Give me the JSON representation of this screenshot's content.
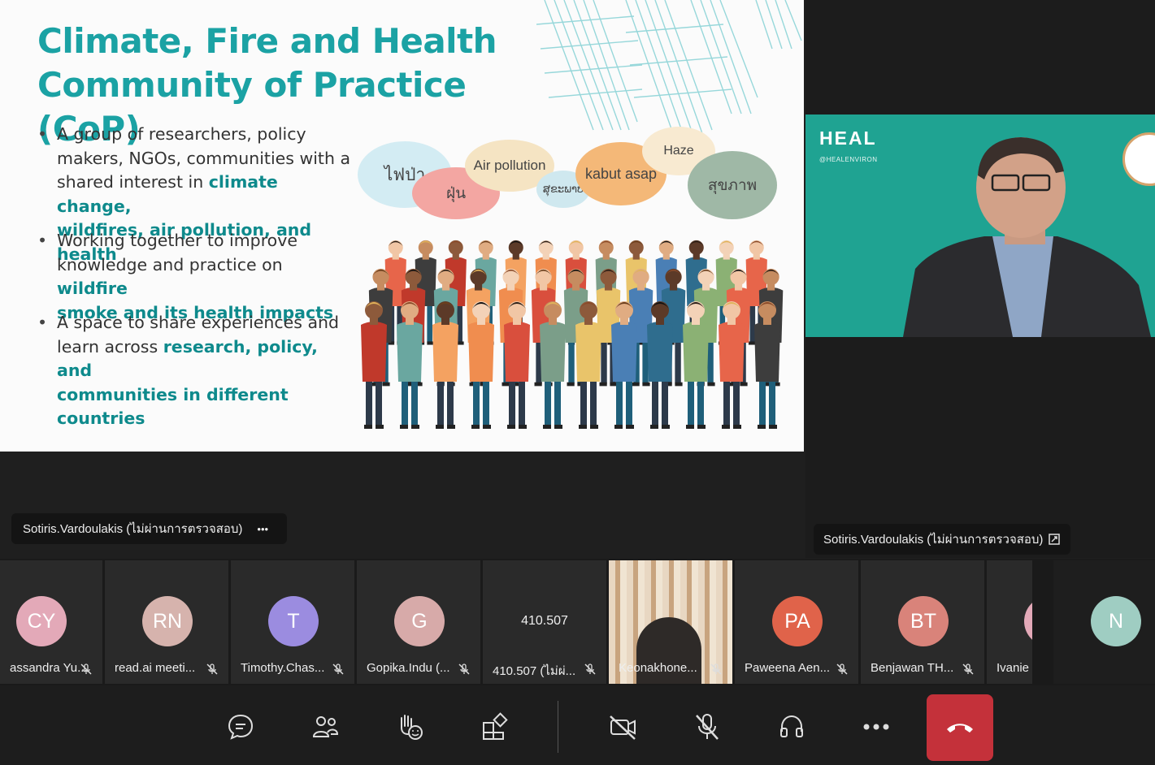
{
  "slide": {
    "title_line1": "Climate, Fire and Health",
    "title_line2": "Community of Practice (CoP)",
    "bullets": [
      {
        "lines": [
          [
            {
              "t": "A group of researchers, policy",
              "h": false
            }
          ],
          [
            {
              "t": "makers, NGOs, communities with a",
              "h": false
            }
          ],
          [
            {
              "t": "shared interest in ",
              "h": false
            },
            {
              "t": "climate change,",
              "h": true
            }
          ],
          [
            {
              "t": "wildfires, air pollution, and health",
              "h": true
            }
          ]
        ]
      },
      {
        "lines": [
          [
            {
              "t": "Working together to improve",
              "h": false
            }
          ],
          [
            {
              "t": "knowledge and practice on ",
              "h": false
            },
            {
              "t": "wildfire",
              "h": true
            }
          ],
          [
            {
              "t": "smoke and its health impacts",
              "h": true
            }
          ]
        ]
      },
      {
        "lines": [
          [
            {
              "t": "A space to share experiences and",
              "h": false
            }
          ],
          [
            {
              "t": "learn across ",
              "h": false
            },
            {
              "t": "research, policy, and",
              "h": true
            }
          ],
          [
            {
              "t": "communities in different countries",
              "h": true
            }
          ]
        ]
      }
    ],
    "bubbles": [
      "ไฟป่า",
      "ฝุ่น",
      "Air pollution",
      "ສຸຂະພາບ",
      "kabut asap",
      "Haze",
      "สุขภาพ"
    ]
  },
  "speaker": {
    "name_label": "Sotiris.Vardoulakis (ไม่ผ่านการตรวจสอบ)",
    "heal_logo": "HEAL",
    "heal_handle": "@HEALENVIRON"
  },
  "presenter_bar": {
    "name_label": "Sotiris.Vardoulakis (ไม่ผ่านการตรวจสอบ)",
    "more_label": "•••"
  },
  "participants": [
    {
      "initials": "CY",
      "name": "assandra Yu...",
      "color": "#e3a9b8"
    },
    {
      "initials": "RN",
      "name": "read.ai meeti...",
      "color": "#d6b3ad"
    },
    {
      "initials": "T",
      "name": "Timothy.Chas...",
      "color": "#9b8ce0"
    },
    {
      "initials": "G",
      "name": "Gopika.Indu (...",
      "color": "#d7aaa9"
    },
    {
      "initials": "410.507",
      "name": "410.507 (ไม่ผ่...",
      "color": ""
    },
    {
      "initials": "",
      "name": "Keonakhone...",
      "color": ""
    },
    {
      "initials": "PA",
      "name": "Paweena Aen...",
      "color": "#e0634a"
    },
    {
      "initials": "BT",
      "name": "Benjawan TH...",
      "color": "#d9837a"
    },
    {
      "initials": "",
      "name": "Ivanie",
      "color": "#e3a9b8"
    },
    {
      "initials": "N",
      "name": "",
      "color": "#9fcdc2"
    }
  ],
  "toolbar": {
    "buttons": [
      "chat-icon",
      "people-icon",
      "react-icon",
      "apps-icon",
      "camera-off-icon",
      "mic-off-icon",
      "headset-icon",
      "more-icon",
      "hangup-icon"
    ],
    "hangup_color": "#c4313a"
  }
}
